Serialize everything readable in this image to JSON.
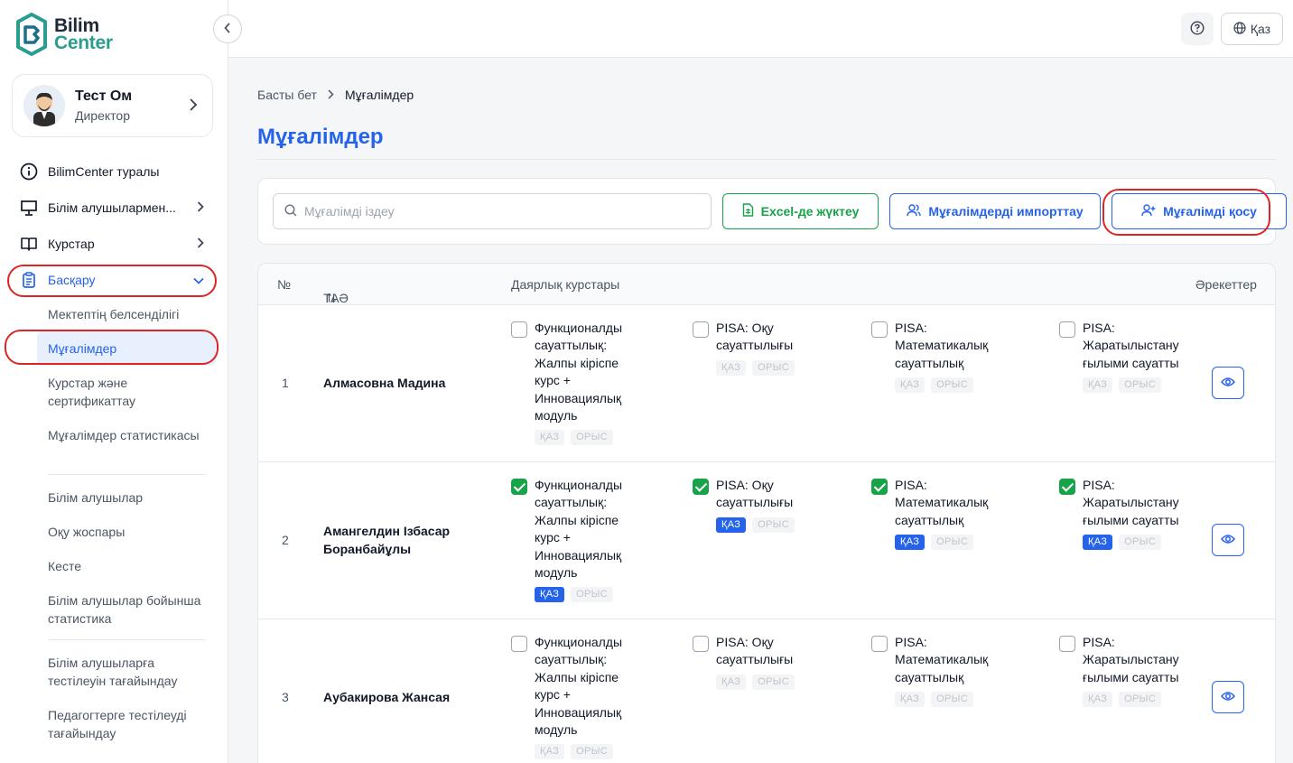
{
  "logo": {
    "line1": "Bilim",
    "line2": "Center"
  },
  "profile": {
    "name": "Тест Ом",
    "role": "Директор"
  },
  "nav": {
    "about": "BilimCenter туралы",
    "students_work": "Білім алушылармен...",
    "courses": "Курстар",
    "manage": "Басқару",
    "sub": {
      "school_activity": "Мектептің белсенділігі",
      "teachers": "Мұғалімдер",
      "courses_cert": "Курстар және сертификаттау",
      "teacher_stats": "Мұғалімдер статистикасы",
      "students": "Білім алушылар",
      "study_plan": "Оқу жоспары",
      "schedule": "Кесте",
      "student_stats": "Білім алушылар бойынша статистика",
      "assign_tests_students": "Білім алушыларға тестілеуін тағайындау",
      "assign_tests_teachers": "Педагогтерге тестілеуді тағайындау"
    }
  },
  "topbar": {
    "lang": "Қаз"
  },
  "breadcrumb": {
    "home": "Басты бет",
    "current": "Мұғалімдер"
  },
  "page_title": "Мұғалімдер",
  "toolbar": {
    "search_placeholder": "Мұғалімді іздеу",
    "excel": "Excel-де жүктеу",
    "import": "Мұғалімдерді импорттау",
    "add": "Мұғалімді қосу"
  },
  "table": {
    "headers": {
      "num": "№",
      "fio": "ТАӘ",
      "courses": "Даярлық курстары",
      "actions": "Әрекеттер"
    },
    "tags": {
      "kaz": "ҚАЗ",
      "rus": "ОРЫС"
    },
    "courses": [
      [
        "Функционалды",
        "сауаттылық:",
        "Жалпы кіріспе",
        "курс +",
        "Инновациялық",
        "модуль"
      ],
      [
        "PISA: Оқу",
        "сауаттылығы"
      ],
      [
        "PISA:",
        "Математикалық",
        "сауаттылық"
      ],
      [
        "PISA:",
        "Жаратылыстану",
        "ғылыми сауатты"
      ]
    ],
    "rows": [
      {
        "num": "1",
        "fio": "Алмасовна Мадина",
        "checked": [
          false,
          false,
          false,
          false
        ],
        "kaz_active": [
          false,
          false,
          false,
          false
        ]
      },
      {
        "num": "2",
        "fio": "Амангелдин Ізбасар Боранбайұлы",
        "checked": [
          true,
          true,
          true,
          true
        ],
        "kaz_active": [
          true,
          true,
          true,
          true
        ]
      },
      {
        "num": "3",
        "fio": "Аубакирова Жансая",
        "checked": [
          false,
          false,
          false,
          false
        ],
        "kaz_active": [
          false,
          false,
          false,
          false
        ]
      }
    ]
  },
  "colors": {
    "primary": "#2563eb",
    "success": "#16a34a",
    "highlight_ring": "#dc2626",
    "brand_teal": "#2a9d8f"
  }
}
